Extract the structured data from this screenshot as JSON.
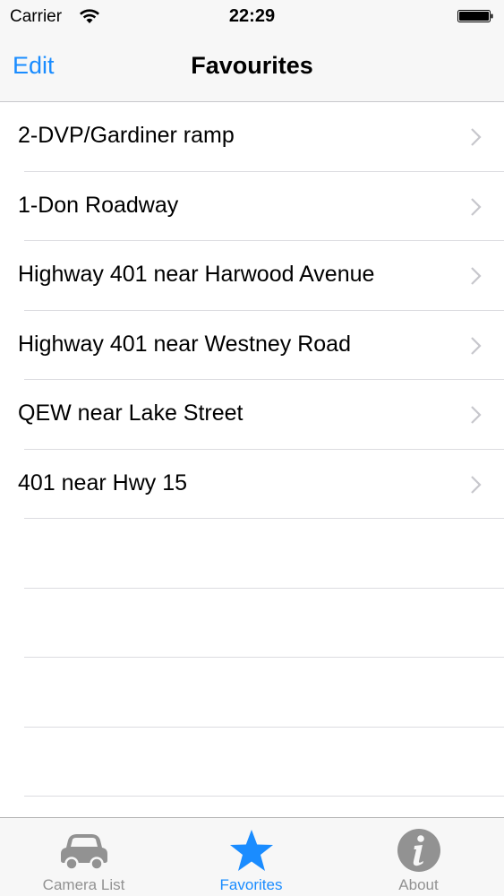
{
  "status_bar": {
    "carrier": "Carrier",
    "time": "22:29"
  },
  "nav": {
    "edit_label": "Edit",
    "title": "Favourites"
  },
  "favourites": [
    {
      "label": "2-DVP/Gardiner ramp"
    },
    {
      "label": "1-Don Roadway"
    },
    {
      "label": "Highway 401 near Harwood Avenue"
    },
    {
      "label": "Highway 401 near Westney Road"
    },
    {
      "label": "QEW near Lake Street"
    },
    {
      "label": "401 near Hwy 15"
    }
  ],
  "tabs": [
    {
      "label": "Camera List",
      "icon": "car-icon",
      "active": false
    },
    {
      "label": "Favorites",
      "icon": "star-icon",
      "active": true
    },
    {
      "label": "About",
      "icon": "info-icon",
      "active": false
    }
  ],
  "colors": {
    "accent": "#1a8cff",
    "inactive": "#929292"
  }
}
